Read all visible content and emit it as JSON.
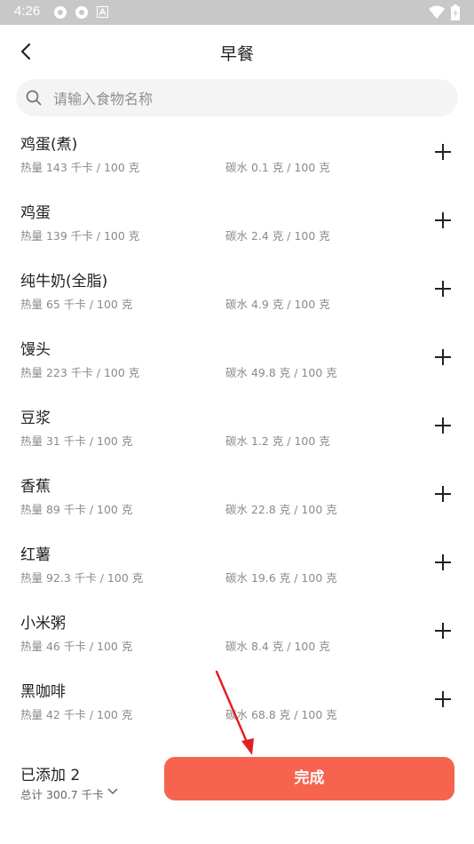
{
  "status_bar": {
    "time": "4:26"
  },
  "header": {
    "title": "早餐"
  },
  "search": {
    "placeholder": "请输入食物名称"
  },
  "foods": [
    {
      "name": "鸡蛋(煮)",
      "calories": "热量 143 千卡 / 100 克",
      "carbs": "碳水 0.1 克 / 100 克"
    },
    {
      "name": "鸡蛋",
      "calories": "热量 139 千卡 / 100 克",
      "carbs": "碳水 2.4 克 / 100 克"
    },
    {
      "name": "纯牛奶(全脂)",
      "calories": "热量 65 千卡 / 100 克",
      "carbs": "碳水 4.9 克 / 100 克"
    },
    {
      "name": "馒头",
      "calories": "热量 223 千卡 / 100 克",
      "carbs": "碳水 49.8 克 / 100 克"
    },
    {
      "name": "豆浆",
      "calories": "热量 31 千卡 / 100 克",
      "carbs": "碳水 1.2 克 / 100 克"
    },
    {
      "name": "香蕉",
      "calories": "热量 89 千卡 / 100 克",
      "carbs": "碳水 22.8 克 / 100 克"
    },
    {
      "name": "红薯",
      "calories": "热量 92.3 千卡 / 100 克",
      "carbs": "碳水 19.6 克 / 100 克"
    },
    {
      "name": "小米粥",
      "calories": "热量 46 千卡 / 100 克",
      "carbs": "碳水 8.4 克 / 100 克"
    },
    {
      "name": "黑咖啡",
      "calories": "热量 42 千卡 / 100 克",
      "carbs": "碳水 68.8 克 / 100 克"
    }
  ],
  "footer": {
    "added_label": "已添加 2",
    "total_label": "总计 300.7 千卡",
    "done_label": "完成"
  },
  "colors": {
    "accent": "#f6644f",
    "annotation_arrow": "#e02020"
  },
  "icons": {
    "back": "back-arrow-icon",
    "search": "search-icon",
    "add": "plus-icon",
    "expand": "chevron-down-icon"
  }
}
